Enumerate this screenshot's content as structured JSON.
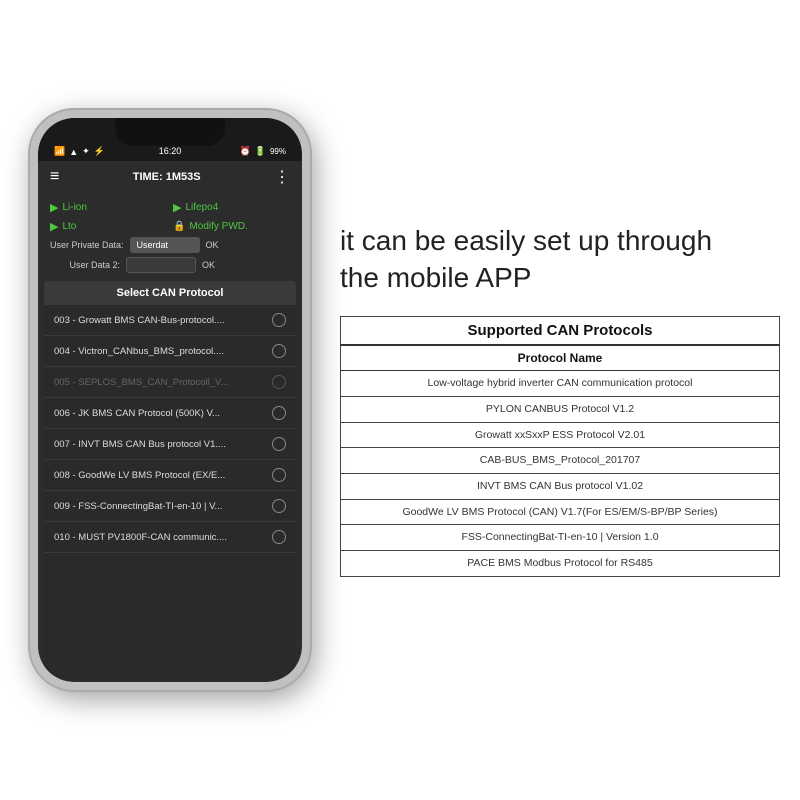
{
  "phone": {
    "status_bar": {
      "left": "📶 WiFi ●●",
      "time": "16:20",
      "right": "⏰ 🔋 99%"
    },
    "header": {
      "title": "TIME: 1M53S",
      "menu_icon": "≡",
      "dots_icon": "⋮"
    },
    "battery_options": [
      {
        "label": "Li-ion",
        "icon": "▶"
      },
      {
        "label": "Lifepo4",
        "icon": "▶"
      },
      {
        "label": "Lto",
        "icon": "▶"
      },
      {
        "label": "Modify PWD.",
        "icon": "🔒"
      }
    ],
    "user_data": [
      {
        "label": "User Private Data:",
        "value": "Userdat",
        "btn": "OK"
      },
      {
        "label": "User Data 2:",
        "value": "",
        "btn": "OK"
      }
    ],
    "can_dropdown": {
      "title": "Select CAN Protocol",
      "items": [
        {
          "label": "003 - Growatt BMS CAN-Bus-protocol....",
          "disabled": false
        },
        {
          "label": "004 - Victron_CANbus_BMS_protocol....",
          "disabled": false
        },
        {
          "label": "005 - SEPLOS_BMS_CAN_Protocoll_V...",
          "disabled": true
        },
        {
          "label": "006 - JK BMS CAN Protocol (500K) V...",
          "disabled": false
        },
        {
          "label": "007 - INVT BMS CAN Bus protocol V1....",
          "disabled": false
        },
        {
          "label": "008 - GoodWe LV BMS Protocol (EX/E...",
          "disabled": false
        },
        {
          "label": "009 - FSS-ConnectingBat-TI-en-10 | V...",
          "disabled": false
        },
        {
          "label": "010 - MUST PV1800F-CAN communic....",
          "disabled": false
        }
      ]
    }
  },
  "right_panel": {
    "tagline": "it can be easily set up through\nthe mobile APP",
    "table": {
      "title": "Supported CAN Protocols",
      "col_header": "Protocol Name",
      "rows": [
        "Low-voltage hybrid inverter CAN communication protocol",
        "PYLON CANBUS Protocol V1.2",
        "Growatt xxSxxP ESS Protocol V2.01",
        "CAB-BUS_BMS_Protocol_201707",
        "INVT BMS CAN Bus protocol V1.02",
        "GoodWe LV BMS Protocol (CAN) V1.7(For ES/EM/S-BP/BP Series)",
        "FSS-ConnectingBat-TI-en-10 | Version 1.0",
        "PACE BMS Modbus Protocol for RS485"
      ]
    }
  }
}
